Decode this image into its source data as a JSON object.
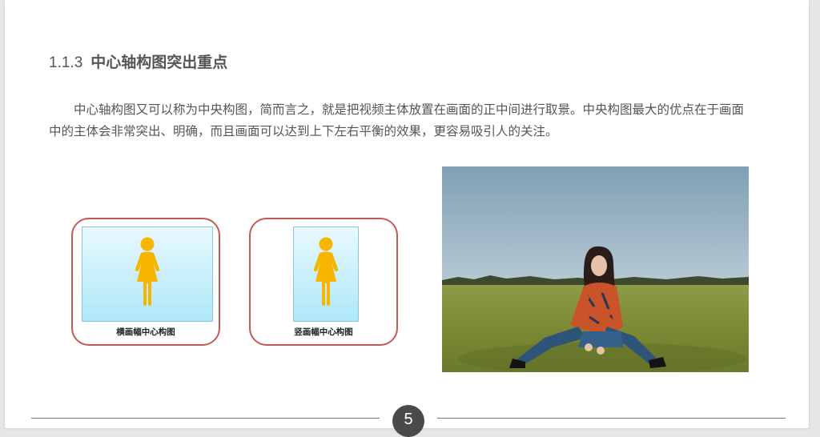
{
  "section": {
    "number": "1.1.3",
    "title": "中心轴构图突出重点"
  },
  "paragraph": "中心轴构图又可以称为中央构图，简而言之，就是把视频主体放置在画面的正中间进行取景。中央构图最大的优点在于画面中的主体会非常突出、明确，而且画面可以达到上下左右平衡的效果，更容易吸引人的关注。",
  "diagrams": [
    {
      "caption": "横画幅中心构图",
      "icon": "female-figure-icon"
    },
    {
      "caption": "竖画幅中心构图",
      "icon": "female-figure-icon"
    }
  ],
  "colors": {
    "figure": "#f7b500",
    "frame_border": "#c45a55",
    "text": "#555555"
  },
  "page_number": "5"
}
